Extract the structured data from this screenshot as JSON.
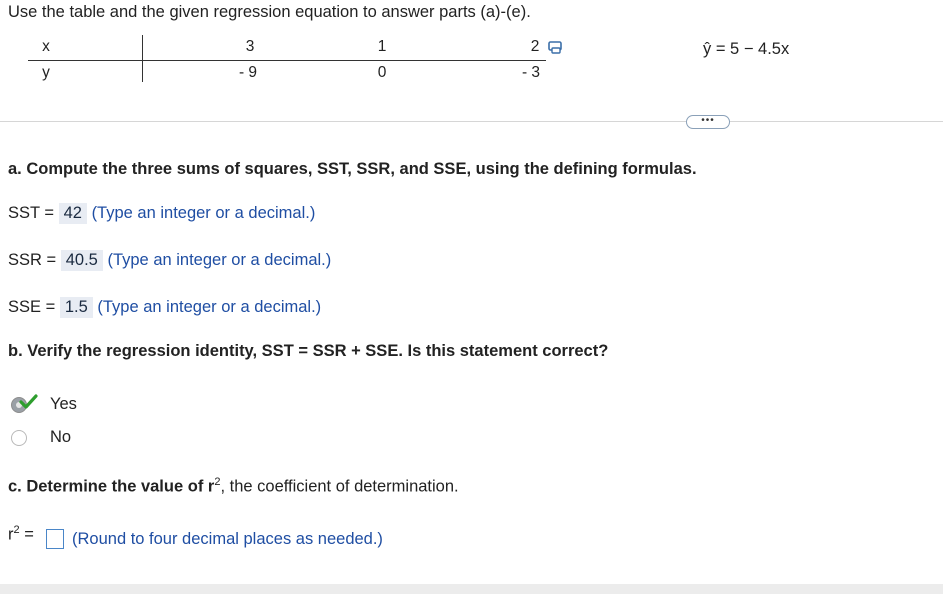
{
  "intro": "Use the table and the given regression equation to answer parts (a)-(e).",
  "table": {
    "x_label": "x",
    "y_label": "y",
    "x_values": [
      "3",
      "1",
      "2"
    ],
    "y_values": [
      "- 9",
      "0",
      "- 3"
    ],
    "copy_icon": "copy-icon"
  },
  "equation": "ŷ = 5 − 4.5x",
  "more_label": "•••",
  "part_a": {
    "question": "a. Compute the three sums of squares, SST, SSR, and SSE, using the defining formulas.",
    "sst_label": "SST =",
    "sst_value": "42",
    "ssr_label": "SSR =",
    "ssr_value": "40.5",
    "sse_label": "SSE =",
    "sse_value": "1.5",
    "hint": "(Type an integer or a decimal.)"
  },
  "part_b": {
    "question": "b. Verify the regression identity, SST = SSR + SSE. Is this statement correct?",
    "options": [
      {
        "label": "Yes",
        "selected": true,
        "correct": true
      },
      {
        "label": "No",
        "selected": false
      }
    ]
  },
  "part_c": {
    "question_pre": "c. Determine the value of r",
    "question_sup": "2",
    "question_post": ", the coefficient of determination.",
    "answer_label": "r",
    "answer_sup": "2",
    "answer_eq": "=",
    "answer_value": "",
    "hint": "(Round to four decimal places as needed.)"
  },
  "colors": {
    "answer_bg": "#e8ecf3",
    "hint": "#1f4ea3",
    "check": "#2e9e2e",
    "input_border": "#4a86c8"
  }
}
